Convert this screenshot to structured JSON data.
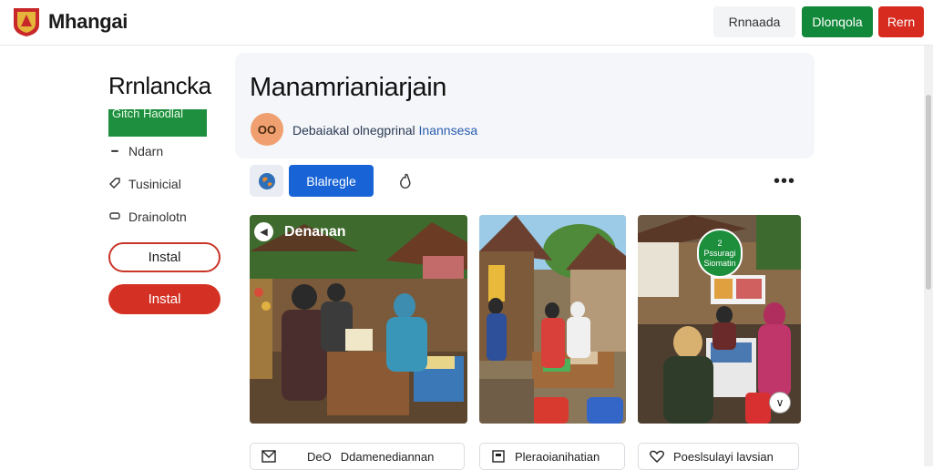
{
  "app": {
    "brand": "Mhangai",
    "brand_colors": {
      "red": "#c8282a",
      "gold": "#e5b43a"
    }
  },
  "topbar": {
    "buttons": [
      {
        "label": "Rnnaada",
        "style": "light"
      },
      {
        "label": "Dlonqola",
        "style": "green",
        "color": "#12883a"
      },
      {
        "label": "Rern",
        "style": "red",
        "color": "#d72b20"
      }
    ]
  },
  "sidebar": {
    "title": "Rrnlancka",
    "green_banner": "Gitch Haodlal",
    "items": [
      {
        "icon": "dash-icon",
        "label": "Ndarn"
      },
      {
        "icon": "tag-icon",
        "label": "Tusinicial"
      },
      {
        "icon": "box-icon",
        "label": "Drainolotn"
      }
    ],
    "install_outline": "Instal",
    "install_filled": "Instal"
  },
  "header": {
    "title": "Manamrianiarjain",
    "avatar_text": "OO",
    "subtitle": "Debaiakal olnegprinal",
    "subtitle_accent": "Inannsesa"
  },
  "actions": {
    "icon": "globe-icon",
    "primary_label": "Blalregle",
    "like_icon": "hand-icon",
    "more_icon": "more-icon"
  },
  "photos": [
    {
      "label": "Denanan",
      "scene": "market-stall"
    },
    {
      "label": "",
      "scene": "village-street"
    },
    {
      "label": "",
      "scene": "kiosk",
      "badge_top": "2",
      "badge_text": "Pssuragi",
      "badge_sub": "Siomatin"
    }
  ],
  "bottom_cards": [
    {
      "icon": "mail-icon",
      "prefix": "DeO",
      "label": "Ddamenediannan"
    },
    {
      "icon": "book-icon",
      "prefix": "",
      "label": "Pleraoianihatian"
    },
    {
      "icon": "heart-icon",
      "prefix": "",
      "label": "Poeslsulayi lavsian"
    }
  ]
}
